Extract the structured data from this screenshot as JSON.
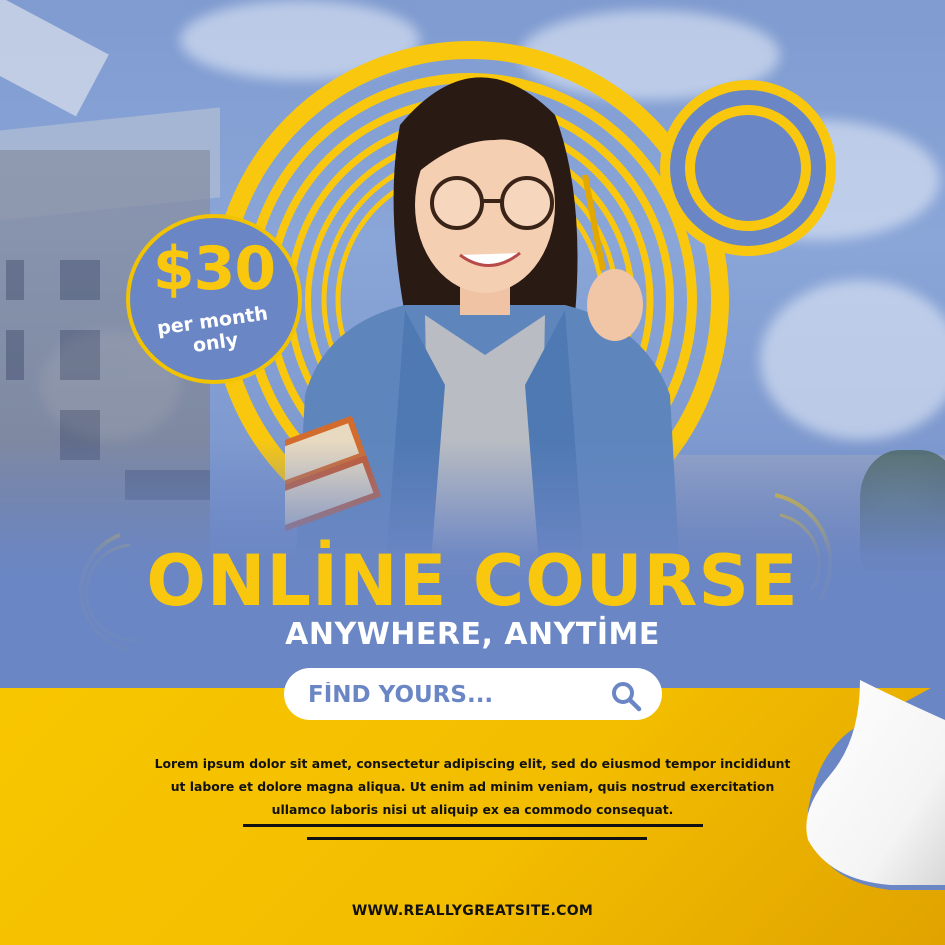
{
  "price": {
    "amount": "$30",
    "line1": "per month",
    "line2": "only"
  },
  "headline": "ONLİNE COURSE",
  "subheadline": "ANYWHERE, ANYTİME",
  "search": {
    "placeholder": "FİND YOURS...",
    "icon": "search-icon"
  },
  "body_text": "Lorem ipsum dolor sit amet, consectetur adipiscing elit, sed do eiusmod tempor incididunt ut labore et dolore magna aliqua. Ut enim ad minim veniam, quis nostrud exercitation ullamco laboris nisi ut aliquip ex ea commodo consequat.",
  "website": "WWW.REALLYGREATSITE.COM",
  "colors": {
    "accent_yellow": "#f9c80e",
    "brand_blue": "#6b86c4",
    "text_dark": "#111111",
    "white": "#ffffff"
  }
}
